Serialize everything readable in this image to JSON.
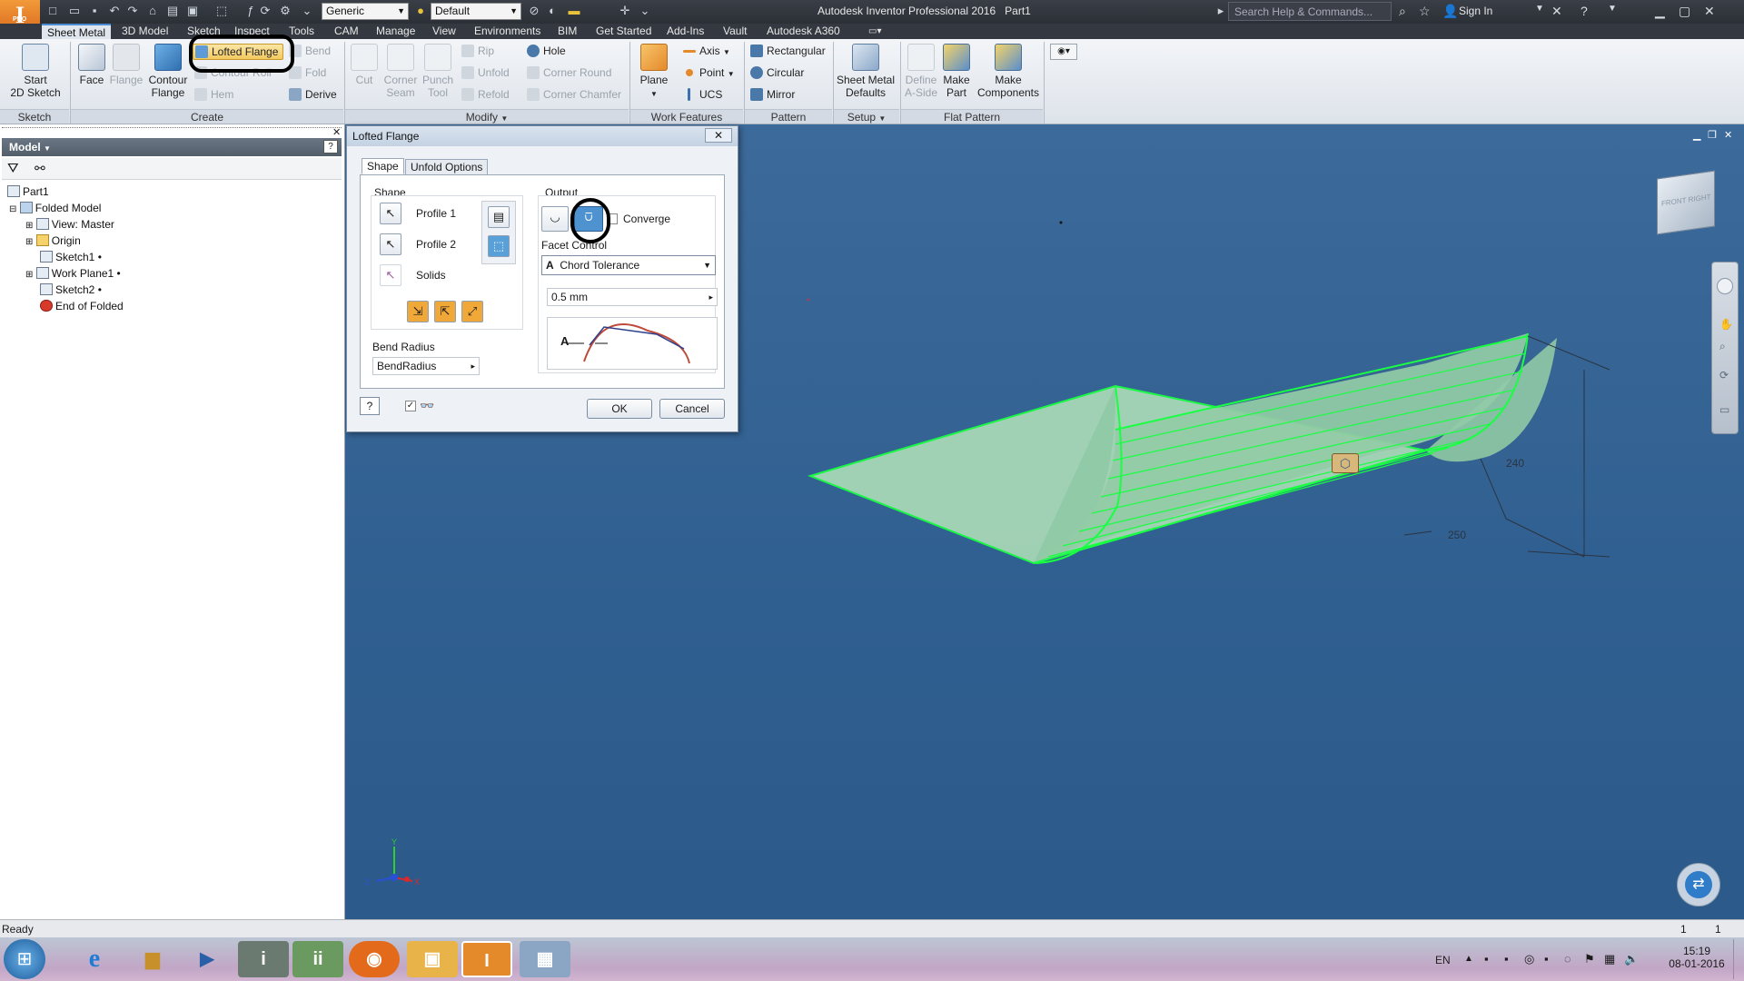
{
  "title_bar": {
    "app_title": "Autodesk Inventor Professional 2016",
    "doc_name": "Part1",
    "material_combo": "Generic",
    "appearance_combo": "Default",
    "search_placeholder": "Search Help & Commands...",
    "sign_in": "Sign In",
    "logo_text": "I",
    "logo_sub": "PRO"
  },
  "menu_tabs": [
    "Sheet Metal",
    "3D Model",
    "Sketch",
    "Inspect",
    "Tools",
    "CAM",
    "Manage",
    "View",
    "Environments",
    "BIM",
    "Get Started",
    "Add-Ins",
    "Vault",
    "Autodesk A360"
  ],
  "ribbon": {
    "sketch": {
      "start_2d_sketch": "Start\n2D Sketch",
      "panel": "Sketch"
    },
    "create": {
      "face": "Face",
      "flange": "Flange",
      "contour_flange": "Contour\nFlange",
      "lofted_flange": "Lofted Flange",
      "contour_roll": "Contour Roll",
      "hem": "Hem",
      "bend": "Bend",
      "fold": "Fold",
      "derive": "Derive",
      "panel": "Create"
    },
    "modify": {
      "cut": "Cut",
      "corner_seam": "Corner\nSeam",
      "punch_tool": "Punch\nTool",
      "rip": "Rip",
      "unfold": "Unfold",
      "refold": "Refold",
      "hole": "Hole",
      "corner_round": "Corner Round",
      "corner_chamfer": "Corner Chamfer",
      "panel": "Modify"
    },
    "work_features": {
      "plane": "Plane",
      "axis": "Axis",
      "point": "Point",
      "ucs": "UCS",
      "panel": "Work Features"
    },
    "pattern": {
      "rectangular": "Rectangular",
      "circular": "Circular",
      "mirror": "Mirror",
      "panel": "Pattern"
    },
    "setup": {
      "sheet_metal_defaults": "Sheet Metal\nDefaults",
      "panel": "Setup"
    },
    "flat_pattern": {
      "define_a_side": "Define\nA-Side",
      "make_part": "Make\nPart",
      "make_components": "Make\nComponents",
      "panel": "Flat Pattern"
    }
  },
  "browser": {
    "header": "Model",
    "items": [
      {
        "label": "Part1",
        "level": 0
      },
      {
        "label": "Folded Model",
        "level": 0
      },
      {
        "label": "View: Master",
        "level": 1
      },
      {
        "label": "Origin",
        "level": 1
      },
      {
        "label": "Sketch1",
        "level": 1
      },
      {
        "label": "Work Plane1",
        "level": 1
      },
      {
        "label": "Sketch2",
        "level": 1
      },
      {
        "label": "End of Folded",
        "level": 1
      }
    ]
  },
  "dialog": {
    "title": "Lofted Flange",
    "tabs": [
      "Shape",
      "Unfold Options"
    ],
    "shape_group": "Shape",
    "profile1": "Profile 1",
    "profile2": "Profile 2",
    "solids": "Solids",
    "output_group": "Output",
    "converge": "Converge",
    "facet_control": "Facet Control",
    "chord_tolerance": "Chord Tolerance",
    "tolerance_value": "0.5 mm",
    "bend_radius_label": "Bend Radius",
    "bend_radius_value": "BendRadius",
    "ok": "OK",
    "cancel": "Cancel",
    "diagram_letter": "A"
  },
  "viewport": {
    "dim_240": "240",
    "dim_250": "250",
    "viewcube_front": "FRONT",
    "viewcube_right": "RIGHT"
  },
  "status": {
    "text": "Ready",
    "count1": "1",
    "count2": "1"
  },
  "taskbar": {
    "lang": "EN",
    "time": "15:19",
    "date": "08-01-2016"
  }
}
